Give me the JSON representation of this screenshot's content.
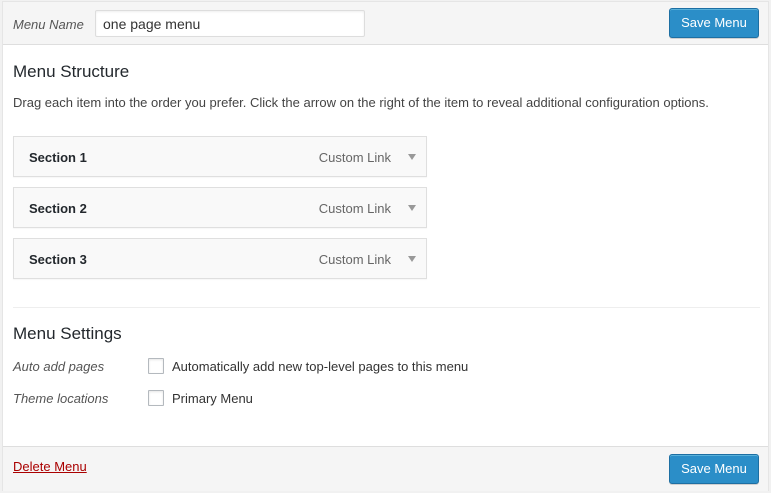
{
  "header": {
    "menu_name_label": "Menu Name",
    "menu_name_value": "one page menu",
    "save_label": "Save Menu"
  },
  "structure": {
    "title": "Menu Structure",
    "instructions": "Drag each item into the order you prefer. Click the arrow on the right of the item to reveal additional configuration options.",
    "items": [
      {
        "title": "Section 1",
        "type": "Custom Link"
      },
      {
        "title": "Section 2",
        "type": "Custom Link"
      },
      {
        "title": "Section 3",
        "type": "Custom Link"
      }
    ]
  },
  "settings": {
    "title": "Menu Settings",
    "auto_add_label": "Auto add pages",
    "auto_add_text": "Automatically add new top-level pages to this menu",
    "theme_locations_label": "Theme locations",
    "primary_menu_text": "Primary Menu"
  },
  "footer": {
    "delete_label": "Delete Menu",
    "save_label": "Save Menu"
  },
  "colors": {
    "primary_button": "#2b8ec8",
    "delete_link": "#aa0000"
  }
}
